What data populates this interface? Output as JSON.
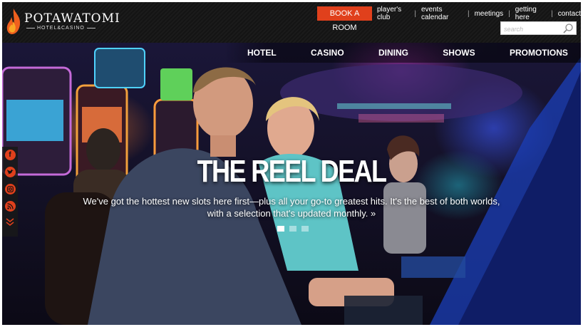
{
  "brand": {
    "name": "POTAWATOMI",
    "sub": "HOTEL&CASINO"
  },
  "top_bar": {
    "book_button": "BOOK A ROOM",
    "utility_links": [
      "player's club",
      "events calendar",
      "meetings",
      "getting here",
      "contact"
    ],
    "search_placeholder": "search"
  },
  "main_nav": [
    "HOTEL",
    "CASINO",
    "DINING",
    "SHOWS",
    "PROMOTIONS"
  ],
  "hero": {
    "headline": "THE REEL DEAL",
    "line1": "We've got the hottest new slots here first—plus all your go-to greatest hits. It's the best of both worlds,",
    "line2": "with a selection that's updated monthly.",
    "more": " »",
    "slide_count": 3,
    "active_slide": 1
  },
  "social": [
    "facebook-icon",
    "twitter-icon",
    "instagram-icon",
    "rss-icon"
  ],
  "colors": {
    "accent": "#e0401c",
    "topbar": "#161616"
  }
}
